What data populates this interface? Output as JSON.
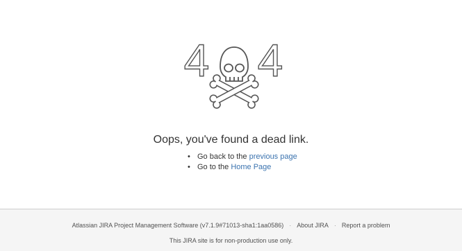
{
  "error": {
    "code_left": "4",
    "code_right": "4",
    "headline": "Oops, you've found a dead link."
  },
  "links": [
    {
      "prefix": "Go back to the ",
      "link_text": "previous page"
    },
    {
      "prefix": "Go to the ",
      "link_text": "Home Page"
    }
  ],
  "footer": {
    "version_text": "Atlassian JIRA Project Management Software (v7.1.9#71013-sha1:1aa0586)",
    "about_label": "About JIRA",
    "report_label": "Report a problem",
    "note": "This JIRA site is for non-production use only.",
    "separator": "·"
  },
  "colors": {
    "link": "#3b73af",
    "illustration_stroke": "#555555",
    "footer_bg": "#f5f5f5"
  },
  "icons": {
    "illustration": "skull-crossbones-icon"
  }
}
